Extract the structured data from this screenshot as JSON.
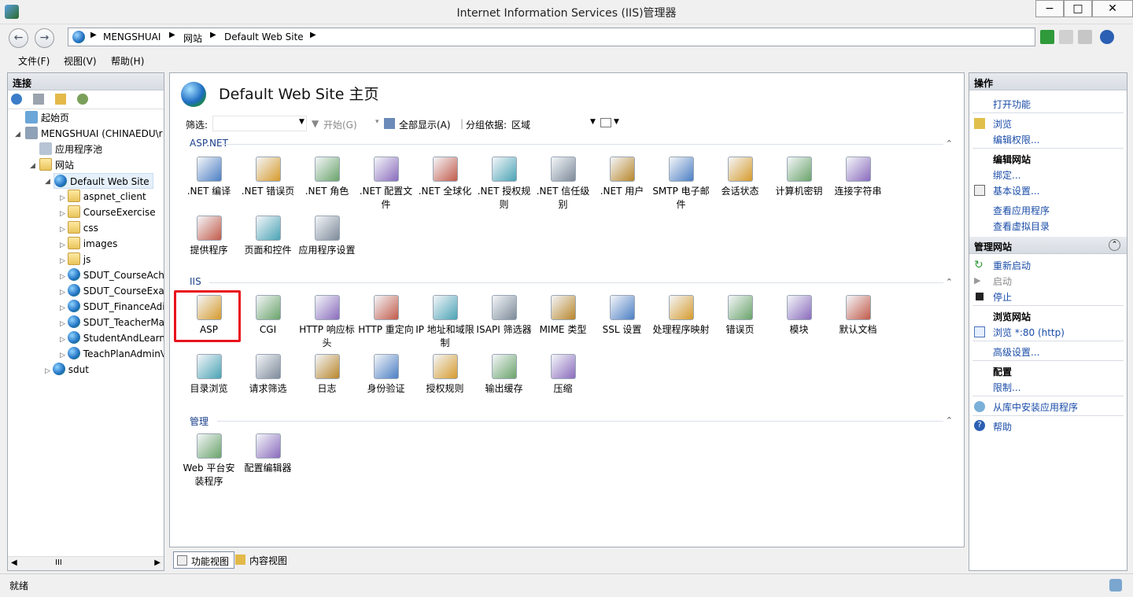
{
  "window": {
    "title": "Internet Information Services (IIS)管理器",
    "min": "−",
    "max": "□",
    "close": "✕"
  },
  "address": {
    "crumbs": [
      "MENGSHUAI",
      "网站",
      "Default Web Site"
    ]
  },
  "menu": [
    "文件(F)",
    "视图(V)",
    "帮助(H)"
  ],
  "left": {
    "header": "连接",
    "tree": [
      {
        "label": "起始页",
        "icon": "start-page-icon"
      },
      {
        "label": "MENGSHUAI (CHINAEDU\\r",
        "icon": "server-icon"
      },
      {
        "label": "应用程序池",
        "icon": "app-pool-icon"
      },
      {
        "label": "网站",
        "icon": "sites-icon"
      },
      {
        "label": "Default Web Site",
        "icon": "globe-icon"
      },
      {
        "label": "aspnet_client",
        "icon": "folder-icon"
      },
      {
        "label": "CourseExercise",
        "icon": "folder-icon"
      },
      {
        "label": "css",
        "icon": "folder-icon"
      },
      {
        "label": "images",
        "icon": "folder-icon"
      },
      {
        "label": "js",
        "icon": "folder-icon"
      },
      {
        "label": "SDUT_CourseAch",
        "icon": "globe-icon"
      },
      {
        "label": "SDUT_CourseExa",
        "icon": "globe-icon"
      },
      {
        "label": "SDUT_FinanceAdi",
        "icon": "globe-icon"
      },
      {
        "label": "SDUT_TeacherMa",
        "icon": "globe-icon"
      },
      {
        "label": "StudentAndLearn",
        "icon": "globe-icon"
      },
      {
        "label": "TeachPlanAdminV",
        "icon": "globe-icon"
      },
      {
        "label": "sdut",
        "icon": "globe-icon"
      }
    ],
    "scroll_mid": "III"
  },
  "center": {
    "title": "Default Web Site 主页",
    "filter": {
      "label": "筛选:",
      "start": "开始(G)",
      "showall": "全部显示(A)",
      "groupby": "分组依据:",
      "group_value": "区域"
    },
    "sections": [
      {
        "name": "ASP.NET",
        "items": [
          ".NET 编译",
          ".NET 错误页",
          ".NET 角色",
          ".NET 配置文件",
          ".NET 全球化",
          ".NET 授权规则",
          ".NET 信任级别",
          ".NET 用户",
          "SMTP 电子邮件",
          "会话状态",
          "计算机密钥",
          "连接字符串",
          "提供程序",
          "页面和控件",
          "应用程序设置"
        ]
      },
      {
        "name": "IIS",
        "items": [
          "ASP",
          "CGI",
          "HTTP 响应标头",
          "HTTP 重定向",
          "IP 地址和域限制",
          "ISAPI 筛选器",
          "MIME 类型",
          "SSL 设置",
          "处理程序映射",
          "错误页",
          "模块",
          "默认文档",
          "目录浏览",
          "请求筛选",
          "日志",
          "身份验证",
          "授权规则",
          "输出缓存",
          "压缩"
        ]
      },
      {
        "name": "管理",
        "items": [
          "Web 平台安装程序",
          "配置编辑器"
        ]
      }
    ],
    "tabs": [
      "功能视图",
      "内容视图"
    ]
  },
  "right": {
    "header": "操作",
    "actions": {
      "open_feature": "打开功能",
      "browse": "浏览",
      "edit_perm": "编辑权限...",
      "edit_site": "编辑网站",
      "bindings": "绑定...",
      "basic": "基本设置...",
      "view_apps": "查看应用程序",
      "view_vdirs": "查看虚拟目录",
      "manage_site": "管理网站",
      "restart": "重新启动",
      "start": "启动",
      "stop": "停止",
      "browse_site": "浏览网站",
      "browse_80": "浏览 *:80 (http)",
      "advanced": "高级设置...",
      "config": "配置",
      "limits": "限制...",
      "install_app": "从库中安装应用程序",
      "help": "帮助"
    }
  },
  "status": "就绪",
  "colors": {
    "highlight": "#e8141c",
    "link": "#1a4ca8"
  }
}
